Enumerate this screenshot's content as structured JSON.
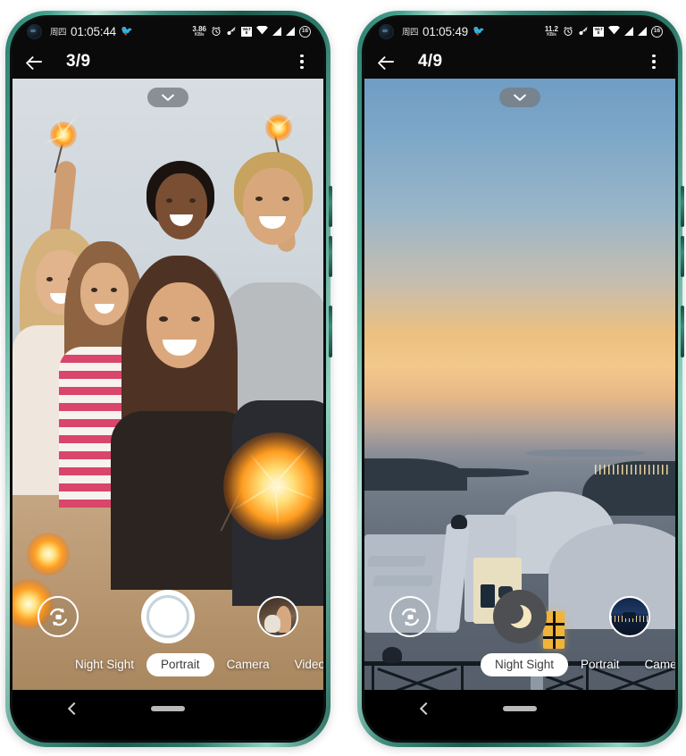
{
  "meta": {
    "scene": "two android phones side by side showing a camera app preview",
    "frame_color": "#2f7f70"
  },
  "phones": [
    {
      "id": "left",
      "status_bar": {
        "day": "周四",
        "time": "01:05:44",
        "bird_icon": "bird-icon",
        "net_speed_value": "3.86",
        "net_speed_unit": "KB/s",
        "icons": [
          "alarm-icon",
          "key-icon",
          "volte-icon",
          "wifi-icon",
          "signal-icon",
          "signal-icon"
        ],
        "volte_label_top": "VoLT",
        "volte_label_bottom": "E",
        "battery_level": "16"
      },
      "app_bar": {
        "back_icon": "back-arrow-icon",
        "title": "3/9",
        "overflow_icon": "more-vertical-icon"
      },
      "viewfinder": {
        "description": "group of five friends taking a beach selfie holding sparklers at dusk",
        "expand_icon": "chevron-down-icon"
      },
      "controls": {
        "flip_label": "flip-camera",
        "shutter_label": "shutter",
        "shutter_style": "white",
        "thumbnail_label": "last-photo-woman-with-dog"
      },
      "modes": [
        {
          "label": "Night Sight",
          "active": false
        },
        {
          "label": "Portrait",
          "active": true
        },
        {
          "label": "Camera",
          "active": false
        },
        {
          "label": "Video",
          "active": false
        }
      ],
      "nav_bar": {
        "back_icon": "nav-back-icon",
        "home_icon": "nav-home-pill"
      }
    },
    {
      "id": "right",
      "status_bar": {
        "day": "周四",
        "time": "01:05:49",
        "bird_icon": "bird-icon",
        "net_speed_value": "11.2",
        "net_speed_unit": "KB/s",
        "icons": [
          "alarm-icon",
          "key-icon",
          "volte-icon",
          "wifi-icon",
          "signal-icon",
          "signal-icon"
        ],
        "volte_label_top": "VoLT",
        "volte_label_bottom": "E",
        "battery_level": "16"
      },
      "app_bar": {
        "back_icon": "back-arrow-icon",
        "title": "4/9",
        "overflow_icon": "more-vertical-icon"
      },
      "viewfinder": {
        "description": "santorini style white buildings overlooking the sea at sunset dusk",
        "expand_icon": "chevron-down-icon"
      },
      "controls": {
        "flip_label": "flip-camera",
        "shutter_label": "shutter",
        "shutter_style": "night-moon",
        "thumbnail_label": "last-photo-night-cityscape"
      },
      "modes": [
        {
          "label": "Night Sight",
          "active": true
        },
        {
          "label": "Portrait",
          "active": false
        },
        {
          "label": "Camera",
          "active": false
        }
      ],
      "nav_bar": {
        "back_icon": "nav-back-icon",
        "home_icon": "nav-home-pill"
      }
    }
  ]
}
